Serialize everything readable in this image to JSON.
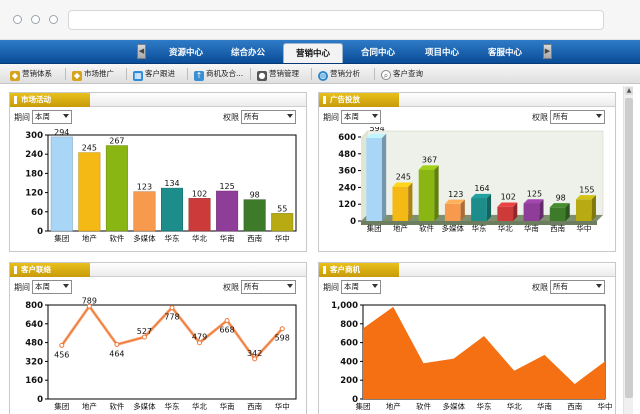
{
  "nav": {
    "tabs": [
      "资源中心",
      "综合办公",
      "营销中心",
      "合同中心",
      "项目中心",
      "客服中心"
    ],
    "active": 2
  },
  "subnav": {
    "items": [
      {
        "label": "营销体系",
        "icon": "tag-icon",
        "color": "#d6a41c"
      },
      {
        "label": "市场推广",
        "icon": "tag-icon",
        "color": "#d6a41c"
      },
      {
        "label": "客户跟进",
        "icon": "calendar-icon",
        "color": "#2f8ad8"
      },
      {
        "label": "商机及合...",
        "icon": "arrow-up-icon",
        "color": "#3a8fd2"
      },
      {
        "label": "营销管理",
        "icon": "user-icon",
        "color": "#555555"
      },
      {
        "label": "营销分析",
        "icon": "globe-icon",
        "color": "#2b86cc"
      },
      {
        "label": "客户查询",
        "icon": "search-icon",
        "color": "#666666"
      }
    ]
  },
  "filters": {
    "period_label": "期间",
    "period_value": "本周",
    "perm_label": "权限",
    "perm_value": "所有"
  },
  "panels": [
    {
      "title": "市场活动"
    },
    {
      "title": "广告投放"
    },
    {
      "title": "客户联络"
    },
    {
      "title": "客户商机"
    }
  ],
  "colors": {
    "nav_blue": "#0a4c97",
    "header_gold": "#d2a812",
    "line_orange": "#f07a3a",
    "area_orange": "#f47012"
  },
  "chart_data": [
    {
      "type": "bar",
      "categories": [
        "集团",
        "地产",
        "软件",
        "多媒体",
        "华东",
        "华北",
        "华南",
        "西南",
        "华中"
      ],
      "values": [
        294,
        245,
        267,
        123,
        134,
        102,
        125,
        98,
        55
      ],
      "ylim": [
        0,
        300
      ],
      "yticks": [
        0,
        60,
        120,
        180,
        240,
        300
      ],
      "bar_colors": [
        "#a9d6f6",
        "#f5b915",
        "#8ab613",
        "#f79a4e",
        "#1c8d8b",
        "#cc3a3a",
        "#8e3e99",
        "#3d7a2a",
        "#b7aa12"
      ]
    },
    {
      "type": "bar",
      "categories": [
        "集团",
        "地产",
        "软件",
        "多媒体",
        "华东",
        "华北",
        "华南",
        "西南",
        "华中"
      ],
      "values": [
        594,
        245,
        367,
        123,
        164,
        102,
        125,
        98,
        155
      ],
      "ylim": [
        0,
        600
      ],
      "yticks": [
        0,
        120,
        240,
        360,
        480,
        600
      ],
      "bar_colors": [
        "#a9d6f6",
        "#f5b915",
        "#8ab613",
        "#f79a4e",
        "#1c8d8b",
        "#cc3a3a",
        "#8e3e99",
        "#3d7a2a",
        "#b7aa12"
      ]
    },
    {
      "type": "line",
      "categories": [
        "集团",
        "地产",
        "软件",
        "多媒体",
        "华东",
        "华北",
        "华南",
        "西南",
        "华中"
      ],
      "values": [
        456,
        789,
        464,
        527,
        778,
        479,
        668,
        342,
        598
      ],
      "ylim": [
        0,
        800
      ],
      "yticks": [
        0,
        160,
        320,
        480,
        640,
        800
      ]
    },
    {
      "type": "area",
      "categories": [
        "集团",
        "地产",
        "软件",
        "多媒体",
        "华东",
        "华北",
        "华南",
        "西南",
        "华中"
      ],
      "values": [
        750,
        980,
        380,
        430,
        670,
        300,
        470,
        160,
        400
      ],
      "ylim": [
        0,
        1000
      ],
      "yticks": [
        "0",
        "200",
        "400",
        "600",
        "800",
        "1,000"
      ]
    }
  ]
}
